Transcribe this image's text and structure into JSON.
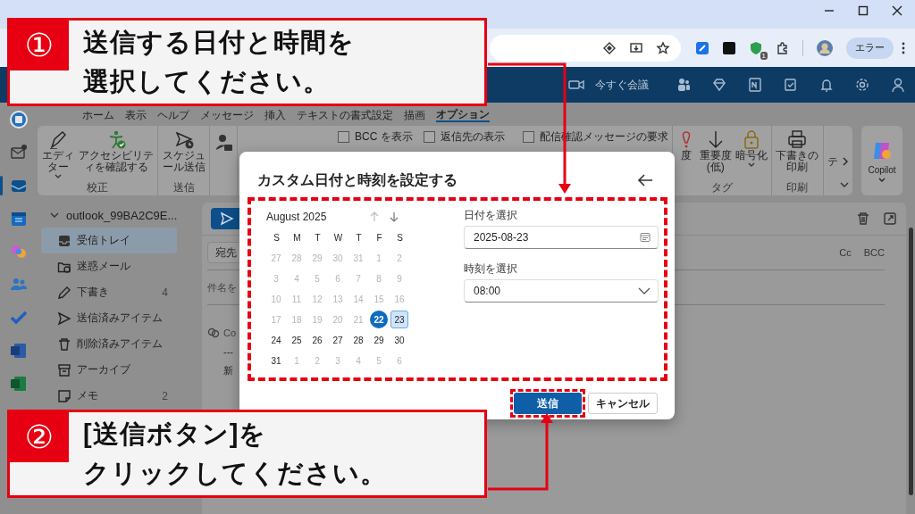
{
  "browser": {
    "extension_badge": "1",
    "profile_button": "エラー"
  },
  "outlook_header": {
    "meet_now": "今すぐ会議"
  },
  "ribbon_tabs": [
    {
      "label": "ホーム",
      "selected": false
    },
    {
      "label": "表示",
      "selected": false
    },
    {
      "label": "ヘルプ",
      "selected": false
    },
    {
      "label": "メッセージ",
      "selected": false
    },
    {
      "label": "挿入",
      "selected": false
    },
    {
      "label": "テキストの書式設定",
      "selected": false
    },
    {
      "label": "描画",
      "selected": false
    },
    {
      "label": "オプション",
      "selected": true
    }
  ],
  "ribbon_groups": [
    {
      "label": "校正",
      "items": [
        {
          "kind": "button",
          "label": "エディター",
          "dropdown": true
        },
        {
          "kind": "button",
          "label": "アクセシビリティを確認する",
          "dropdown": false
        }
      ]
    },
    {
      "label": "送信",
      "items": [
        {
          "kind": "button",
          "label": "スケジュール送信",
          "dropdown": false
        }
      ]
    },
    {
      "items": [
        {
          "kind": "icon"
        }
      ]
    },
    {
      "items": [
        {
          "kind": "checkbox",
          "label": "BCC を表示",
          "checked": false
        },
        {
          "kind": "checkbox",
          "label": "返信先の表示",
          "checked": false
        },
        {
          "kind": "checkbox",
          "label": "配信確認メッセージの要求",
          "checked": false
        }
      ]
    },
    {
      "label": "タグ",
      "items": [
        {
          "kind": "button",
          "label": "度",
          "dropdown": false
        },
        {
          "kind": "button",
          "label": "重要度\n(低)",
          "dropdown": false
        },
        {
          "kind": "button",
          "label": "暗号化",
          "dropdown": true
        }
      ]
    },
    {
      "label": "印刷",
      "items": [
        {
          "kind": "button",
          "label": "下書きの印刷",
          "dropdown": false
        }
      ]
    },
    {
      "items": [
        {
          "kind": "button",
          "label": "テ",
          "dropdown": false
        }
      ]
    }
  ],
  "copilot": {
    "label": "Copilot"
  },
  "folders": {
    "account": "outlook_99BA2C9E...",
    "items": [
      {
        "label": "受信トレイ",
        "selected": true
      },
      {
        "label": "迷惑メール",
        "selected": false
      },
      {
        "label": "下書き",
        "count": "4",
        "selected": false
      },
      {
        "label": "送信済みアイテム",
        "selected": false
      },
      {
        "label": "削除済みアイテム",
        "selected": false
      },
      {
        "label": "アーカイブ",
        "selected": false
      },
      {
        "label": "メモ",
        "count": "2",
        "selected": false
      }
    ]
  },
  "compose": {
    "to": "宛先",
    "cc": "Cc",
    "bcc": "BCC",
    "subject_placeholder": "件名を",
    "copilot_hint": "Co",
    "body_lines": [
      "---",
      "新"
    ]
  },
  "dialog": {
    "title": "カスタム日付と時刻を設定する",
    "month": "August 2025",
    "weekdays": [
      "S",
      "M",
      "T",
      "W",
      "T",
      "F",
      "S"
    ],
    "weeks": [
      [
        {
          "day": "27",
          "disabled": true,
          "today": false,
          "selected": false
        },
        {
          "day": "28",
          "disabled": true,
          "today": false,
          "selected": false
        },
        {
          "day": "29",
          "disabled": true,
          "today": false,
          "selected": false
        },
        {
          "day": "30",
          "disabled": true,
          "today": false,
          "selected": false
        },
        {
          "day": "31",
          "disabled": true,
          "today": false,
          "selected": false
        },
        {
          "day": "1",
          "disabled": true,
          "today": false,
          "selected": false
        },
        {
          "day": "2",
          "disabled": true,
          "today": false,
          "selected": false
        }
      ],
      [
        {
          "day": "3",
          "disabled": true,
          "today": false,
          "selected": false
        },
        {
          "day": "4",
          "disabled": true,
          "today": false,
          "selected": false
        },
        {
          "day": "5",
          "disabled": true,
          "today": false,
          "selected": false
        },
        {
          "day": "6",
          "disabled": true,
          "today": false,
          "selected": false
        },
        {
          "day": "7",
          "disabled": true,
          "today": false,
          "selected": false
        },
        {
          "day": "8",
          "disabled": true,
          "today": false,
          "selected": false
        },
        {
          "day": "9",
          "disabled": true,
          "today": false,
          "selected": false
        }
      ],
      [
        {
          "day": "10",
          "disabled": true,
          "today": false,
          "selected": false
        },
        {
          "day": "11",
          "disabled": true,
          "today": false,
          "selected": false
        },
        {
          "day": "12",
          "disabled": true,
          "today": false,
          "selected": false
        },
        {
          "day": "13",
          "disabled": true,
          "today": false,
          "selected": false
        },
        {
          "day": "14",
          "disabled": true,
          "today": false,
          "selected": false
        },
        {
          "day": "15",
          "disabled": true,
          "today": false,
          "selected": false
        },
        {
          "day": "16",
          "disabled": true,
          "today": false,
          "selected": false
        }
      ],
      [
        {
          "day": "17",
          "disabled": true,
          "today": false,
          "selected": false
        },
        {
          "day": "18",
          "disabled": true,
          "today": false,
          "selected": false
        },
        {
          "day": "19",
          "disabled": true,
          "today": false,
          "selected": false
        },
        {
          "day": "20",
          "disabled": true,
          "today": false,
          "selected": false
        },
        {
          "day": "21",
          "disabled": true,
          "today": false,
          "selected": false
        },
        {
          "day": "22",
          "disabled": false,
          "today": true,
          "selected": false
        },
        {
          "day": "23",
          "disabled": false,
          "today": false,
          "selected": true
        }
      ],
      [
        {
          "day": "24",
          "disabled": false,
          "today": false,
          "selected": false
        },
        {
          "day": "25",
          "disabled": false,
          "today": false,
          "selected": false
        },
        {
          "day": "26",
          "disabled": false,
          "today": false,
          "selected": false
        },
        {
          "day": "27",
          "disabled": false,
          "today": false,
          "selected": false
        },
        {
          "day": "28",
          "disabled": false,
          "today": false,
          "selected": false
        },
        {
          "day": "29",
          "disabled": false,
          "today": false,
          "selected": false
        },
        {
          "day": "30",
          "disabled": false,
          "today": false,
          "selected": false
        }
      ],
      [
        {
          "day": "31",
          "disabled": false,
          "today": false,
          "selected": false
        },
        {
          "day": "1",
          "disabled": true,
          "today": false,
          "selected": false
        },
        {
          "day": "2",
          "disabled": true,
          "today": false,
          "selected": false
        },
        {
          "day": "3",
          "disabled": true,
          "today": false,
          "selected": false
        },
        {
          "day": "4",
          "disabled": true,
          "today": false,
          "selected": false
        },
        {
          "day": "5",
          "disabled": true,
          "today": false,
          "selected": false
        },
        {
          "day": "6",
          "disabled": true,
          "today": false,
          "selected": false
        }
      ]
    ],
    "date_label": "日付を選択",
    "date_value": "2025-08-23",
    "time_label": "時刻を選択",
    "time_value": "08:00",
    "buttons": [
      {
        "kind": "primary",
        "label": "送信"
      },
      {
        "kind": "secondary",
        "label": "キャンセル"
      }
    ]
  },
  "annotations": [
    {
      "number": "①",
      "lines": [
        "送信する日付と時間を",
        "選択してください。"
      ]
    },
    {
      "number": "②",
      "lines": [
        "[送信ボタン]を",
        "クリックしてください。"
      ]
    }
  ]
}
